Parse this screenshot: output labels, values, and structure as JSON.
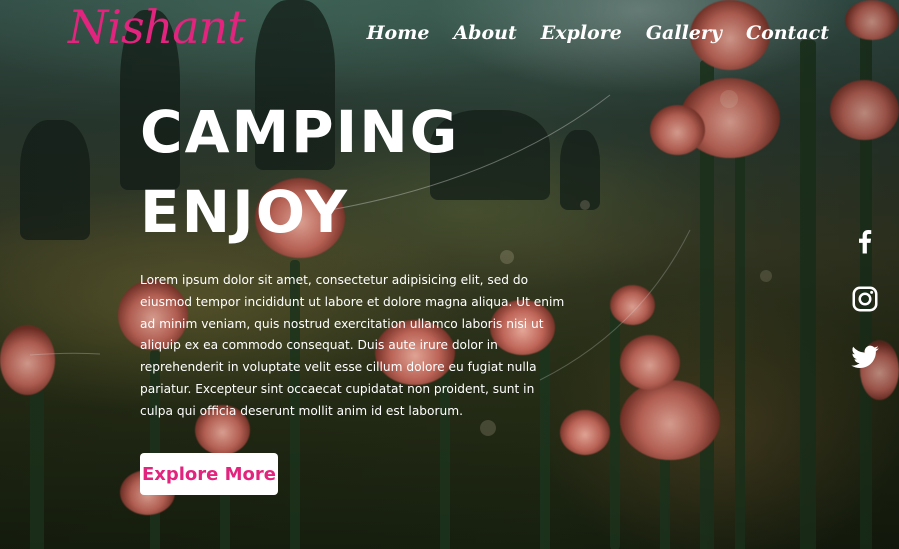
{
  "brand": {
    "logo_text": "Nishant",
    "accent_color": "#e3247e"
  },
  "nav": {
    "items": [
      {
        "label": "Home"
      },
      {
        "label": "About"
      },
      {
        "label": "Explore"
      },
      {
        "label": "Gallery"
      },
      {
        "label": "Contact"
      }
    ]
  },
  "hero": {
    "title_line1": "CAMPING",
    "title_line2": "ENJOY",
    "body": "Lorem ipsum dolor sit amet, consectetur adipisicing elit, sed do eiusmod tempor incididunt ut labore et dolore magna aliqua. Ut enim ad minim veniam, quis nostrud exercitation ullamco laboris nisi ut aliquip ex ea commodo consequat. Duis aute irure dolor in reprehenderit in voluptate velit esse cillum dolore eu fugiat nulla pariatur. Excepteur sint occaecat cupidatat non proident, sunt in culpa qui officia deserunt mollit anim id est laborum.",
    "cta_label": "Explore More"
  },
  "social": {
    "icons": [
      "facebook-icon",
      "instagram-icon",
      "twitter-icon"
    ]
  }
}
